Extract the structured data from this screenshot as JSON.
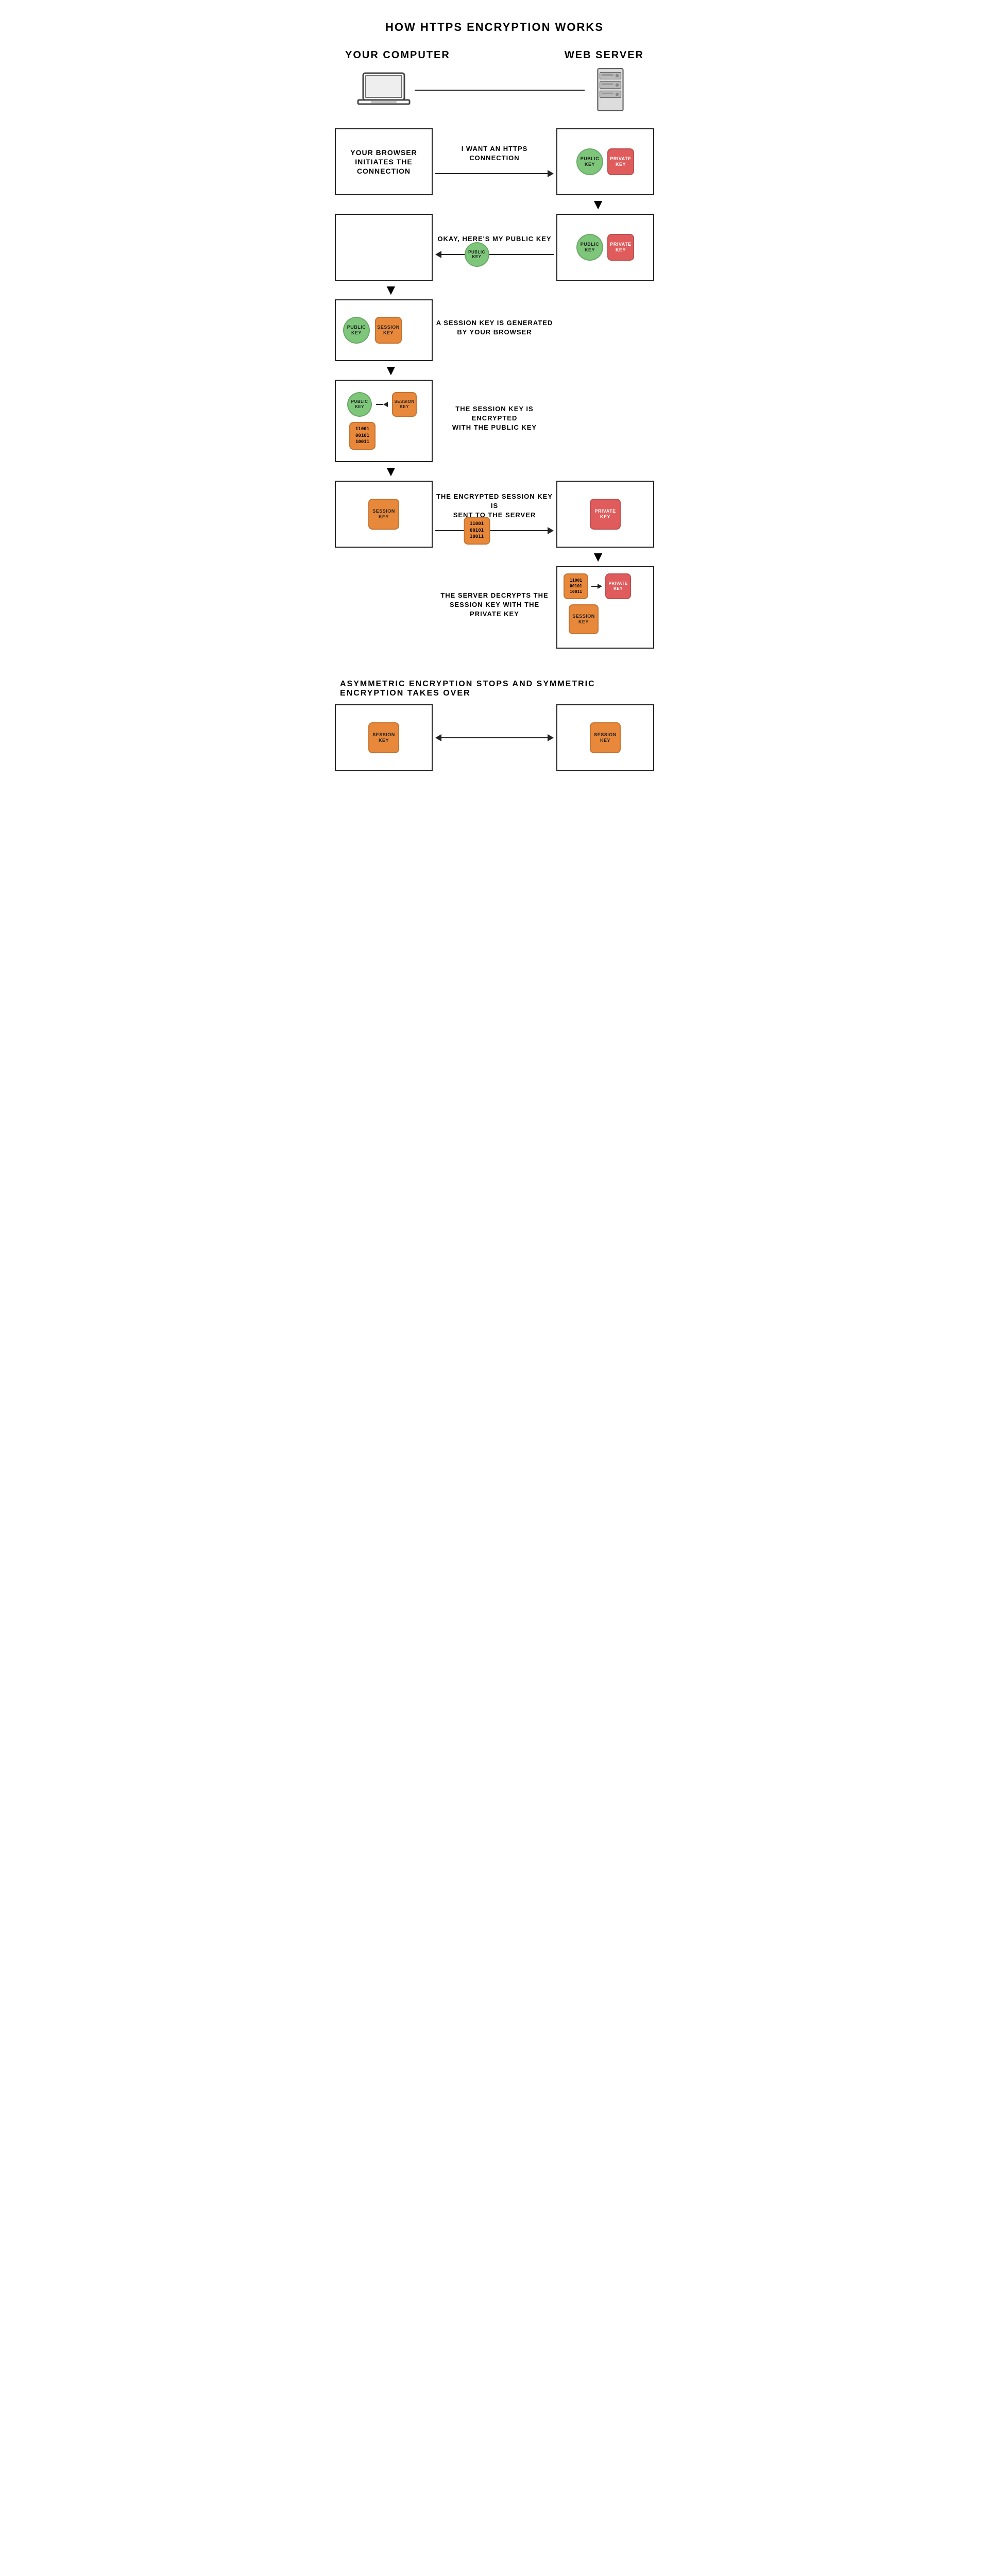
{
  "title": "HOW HTTPS ENCRYPTION WORKS",
  "labels": {
    "your_computer": "YOUR COMPUTER",
    "web_server": "WEB SERVER"
  },
  "steps": [
    {
      "id": "step1",
      "left_box_text": "YOUR BROWSER INITIATES THE CONNECTION",
      "middle_text": "I WANT AN HTTPS CONNECTION",
      "right_keys": [
        "PUBLIC KEY",
        "PRIVATE KEY"
      ],
      "arrow_direction": "right"
    },
    {
      "id": "step2",
      "middle_text": "OKAY, HERE'S MY PUBLIC KEY",
      "right_keys": [
        "PUBLIC KEY",
        "PRIVATE KEY"
      ],
      "traveling_key": "PUBLIC KEY",
      "arrow_direction": "left"
    },
    {
      "id": "step3",
      "left_keys": [
        "PUBLIC KEY",
        "SESSION KEY"
      ],
      "middle_text": "A SESSION KEY IS GENERATED BY YOUR BROWSER"
    },
    {
      "id": "step4",
      "middle_text": "THE SESSION KEY IS ENCRYPTED WITH THE PUBLIC KEY",
      "encrypted_text": "11001\n00101\n10011"
    },
    {
      "id": "step5",
      "left_session": "SESSION KEY",
      "middle_text": "THE ENCRYPTED SESSION KEY IS SENT TO THE SERVER",
      "encrypted_text": "11001\n00101\n10011",
      "right_key": "PRIVATE KEY",
      "arrow_direction": "right"
    },
    {
      "id": "step6",
      "middle_text": "THE SERVER DECRYPTS THE SESSION KEY WITH THE PRIVATE KEY",
      "encrypted_text": "11001\n00101\n10011",
      "right_private": "PRIVATE KEY",
      "right_session": "SESSION KEY"
    }
  ],
  "bottom_label": "ASYMMETRIC ENCRYPTION STOPS AND SYMMETRIC ENCRYPTION TAKES OVER",
  "bottom_session_left": "SESSION KEY",
  "bottom_session_right": "SESSION KEY"
}
